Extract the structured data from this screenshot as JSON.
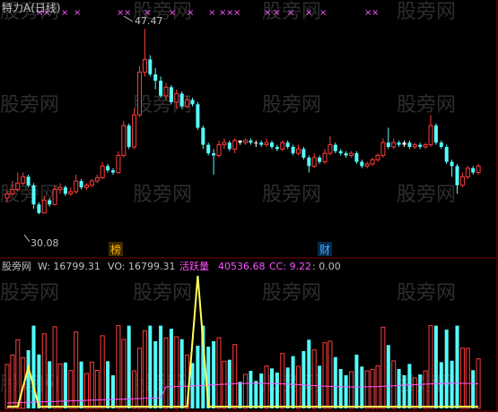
{
  "header": {
    "title": "特力A(日线)",
    "markers_label": "×",
    "high_label": "47.47",
    "low_label": "30.08",
    "badge_left": "榜",
    "badge_right": "财"
  },
  "volume_header": {
    "source": "股旁网",
    "w_label": "W: 16799.31",
    "vo_label": "VO: 16799.31",
    "active_label": "活跃量",
    "active_value": "40536.68",
    "cc_label": "CC: 9.22",
    "zero_label": ": 0.00"
  },
  "watermark": "股旁网",
  "colors": {
    "up": "#ff3c3c",
    "down": "#54fcfc",
    "flat": "#ffffff",
    "active_line": "#ffff54",
    "avg_line": "#ff54ff",
    "grid": "#7d0000",
    "marker": "#ff54ff",
    "text": "#c0c0c0"
  },
  "chart_data": {
    "type": "candlestick",
    "price_range": [
      28,
      49
    ],
    "high": 47.47,
    "low": 30.08,
    "candles": [
      [
        31.6,
        32.0,
        31.2,
        32.3,
        "u"
      ],
      [
        32.0,
        32.4,
        31.8,
        33.2,
        "u"
      ],
      [
        32.4,
        33.0,
        32.2,
        34.0,
        "u"
      ],
      [
        33.0,
        33.6,
        32.8,
        34.0,
        "u"
      ],
      [
        33.6,
        32.8,
        32.6,
        33.8,
        "d"
      ],
      [
        32.8,
        31.0,
        30.6,
        33.0,
        "d"
      ],
      [
        31.0,
        30.2,
        30.08,
        31.2,
        "d"
      ],
      [
        30.2,
        31.4,
        30.2,
        31.8,
        "u"
      ],
      [
        31.4,
        31.0,
        30.8,
        31.6,
        "d"
      ],
      [
        31.0,
        32.4,
        30.9,
        32.8,
        "u"
      ],
      [
        32.4,
        32.6,
        32.0,
        33.0,
        "u"
      ],
      [
        32.6,
        32.0,
        31.8,
        32.8,
        "d"
      ],
      [
        32.0,
        32.2,
        31.8,
        32.6,
        "u"
      ],
      [
        32.2,
        33.2,
        32.0,
        33.8,
        "u"
      ],
      [
        33.2,
        32.6,
        32.4,
        33.4,
        "d"
      ],
      [
        32.6,
        32.8,
        32.4,
        33.0,
        "u"
      ],
      [
        32.8,
        33.2,
        32.6,
        33.4,
        "u"
      ],
      [
        33.2,
        33.5,
        33.0,
        33.8,
        "u"
      ],
      [
        33.5,
        34.6,
        33.4,
        35.0,
        "u"
      ],
      [
        34.6,
        34.2,
        34.0,
        34.8,
        "d"
      ],
      [
        34.2,
        34.0,
        33.8,
        34.4,
        "d"
      ],
      [
        34.0,
        35.6,
        33.9,
        36.0,
        "u"
      ],
      [
        35.6,
        38.4,
        35.4,
        38.8,
        "u"
      ],
      [
        38.4,
        36.4,
        36.2,
        38.6,
        "d"
      ],
      [
        36.4,
        39.4,
        36.2,
        40.0,
        "u"
      ],
      [
        39.4,
        43.4,
        39.2,
        44.0,
        "u"
      ],
      [
        43.4,
        44.6,
        43.0,
        47.47,
        "u"
      ],
      [
        44.6,
        43.2,
        43.0,
        45.0,
        "d"
      ],
      [
        43.2,
        42.6,
        41.8,
        43.8,
        "d"
      ],
      [
        42.6,
        41.2,
        41.0,
        43.0,
        "d"
      ],
      [
        41.2,
        42.0,
        40.8,
        42.4,
        "u"
      ],
      [
        42.0,
        40.6,
        40.4,
        42.2,
        "d"
      ],
      [
        40.6,
        41.4,
        40.0,
        41.8,
        "u"
      ],
      [
        41.4,
        40.2,
        40.0,
        41.6,
        "d"
      ],
      [
        40.2,
        40.8,
        40.0,
        41.2,
        "u"
      ],
      [
        40.8,
        40.4,
        40.2,
        41.0,
        "d"
      ],
      [
        40.4,
        38.2,
        38.0,
        40.6,
        "d"
      ],
      [
        38.2,
        36.6,
        36.2,
        38.4,
        "d"
      ],
      [
        36.6,
        35.8,
        35.6,
        36.8,
        "d"
      ],
      [
        35.8,
        35.6,
        33.8,
        36.2,
        "d"
      ],
      [
        35.6,
        36.6,
        35.4,
        37.0,
        "u"
      ],
      [
        36.6,
        36.8,
        36.2,
        37.2,
        "u"
      ],
      [
        36.8,
        36.2,
        36.0,
        37.0,
        "d"
      ],
      [
        36.2,
        37.0,
        35.8,
        37.2,
        "u"
      ],
      [
        37.0,
        36.8,
        36.6,
        37.0,
        "f"
      ],
      [
        36.8,
        37.0,
        36.6,
        37.2,
        "u"
      ],
      [
        37.0,
        36.8,
        36.6,
        37.2,
        "d"
      ],
      [
        36.8,
        36.8,
        36.4,
        37.0,
        "f"
      ],
      [
        36.8,
        36.6,
        36.4,
        37.0,
        "d"
      ],
      [
        36.6,
        36.8,
        36.4,
        37.2,
        "u"
      ],
      [
        36.8,
        36.4,
        36.2,
        37.0,
        "d"
      ],
      [
        36.4,
        36.2,
        36.0,
        36.6,
        "d"
      ],
      [
        36.2,
        36.8,
        36.0,
        37.0,
        "u"
      ],
      [
        36.8,
        36.4,
        36.2,
        37.0,
        "d"
      ],
      [
        36.4,
        35.8,
        35.6,
        36.6,
        "d"
      ],
      [
        35.8,
        36.2,
        35.6,
        36.6,
        "u"
      ],
      [
        36.2,
        35.4,
        35.2,
        36.4,
        "d"
      ],
      [
        35.4,
        34.6,
        34.0,
        35.6,
        "d"
      ],
      [
        34.6,
        35.4,
        34.4,
        35.8,
        "u"
      ],
      [
        35.4,
        35.0,
        34.8,
        35.6,
        "d"
      ],
      [
        35.0,
        35.8,
        34.8,
        36.2,
        "u"
      ],
      [
        35.8,
        36.6,
        35.6,
        37.4,
        "u"
      ],
      [
        36.6,
        36.0,
        35.8,
        36.8,
        "d"
      ],
      [
        36.0,
        35.8,
        35.6,
        36.2,
        "d"
      ],
      [
        35.8,
        35.6,
        35.4,
        36.0,
        "d"
      ],
      [
        35.6,
        35.8,
        35.4,
        36.0,
        "u"
      ],
      [
        35.8,
        35.0,
        34.8,
        36.0,
        "d"
      ],
      [
        35.0,
        34.6,
        34.4,
        35.2,
        "d"
      ],
      [
        34.6,
        34.8,
        34.4,
        35.0,
        "u"
      ],
      [
        34.8,
        35.2,
        34.6,
        35.4,
        "u"
      ],
      [
        35.2,
        35.6,
        35.0,
        35.8,
        "u"
      ],
      [
        35.6,
        36.8,
        35.4,
        37.2,
        "u"
      ],
      [
        36.8,
        36.4,
        36.2,
        38.2,
        "d"
      ],
      [
        36.4,
        36.8,
        36.2,
        37.2,
        "u"
      ],
      [
        36.8,
        36.6,
        36.4,
        37.0,
        "d"
      ],
      [
        36.6,
        36.8,
        36.4,
        37.0,
        "f"
      ],
      [
        36.8,
        36.4,
        36.2,
        37.0,
        "d"
      ],
      [
        36.4,
        36.6,
        36.2,
        36.8,
        "u"
      ],
      [
        36.6,
        36.4,
        36.2,
        36.8,
        "d"
      ],
      [
        36.4,
        36.6,
        36.2,
        36.8,
        "u"
      ],
      [
        36.6,
        38.4,
        36.4,
        39.4,
        "u"
      ],
      [
        38.4,
        36.8,
        36.6,
        38.6,
        "d"
      ],
      [
        36.8,
        36.4,
        36.2,
        37.0,
        "d"
      ],
      [
        36.4,
        35.0,
        34.8,
        36.6,
        "d"
      ],
      [
        35.0,
        34.6,
        33.6,
        35.2,
        "d"
      ],
      [
        34.6,
        32.8,
        32.0,
        34.8,
        "d"
      ],
      [
        32.8,
        33.6,
        32.6,
        34.0,
        "u"
      ],
      [
        33.6,
        34.4,
        33.4,
        34.6,
        "u"
      ],
      [
        34.4,
        34.0,
        33.8,
        34.6,
        "d"
      ],
      [
        34.0,
        34.6,
        33.8,
        34.8,
        "u"
      ]
    ],
    "volume_range": [
      0,
      16799.31
    ],
    "active_volume_peak": 16799.31
  }
}
